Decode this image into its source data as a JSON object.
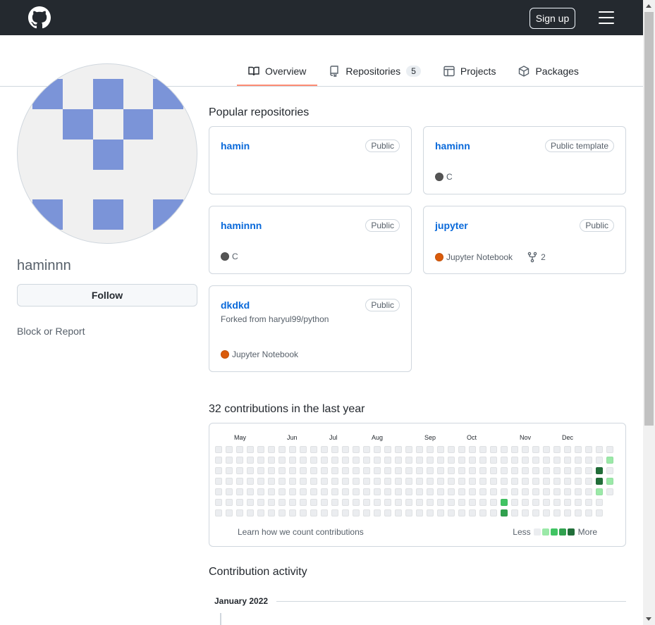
{
  "header": {
    "logo_icon": "github-mark-icon",
    "signup_label": "Sign up",
    "menu_icon": "hamburger-menu-icon"
  },
  "tabs": [
    {
      "label": "Overview",
      "icon": "book-icon",
      "active": true
    },
    {
      "label": "Repositories",
      "icon": "repo-icon",
      "count": "5"
    },
    {
      "label": "Projects",
      "icon": "table-icon"
    },
    {
      "label": "Packages",
      "icon": "package-icon"
    }
  ],
  "profile": {
    "username": "haminnn",
    "follow_label": "Follow",
    "block_label": "Block or Report",
    "avatar_color": "#7b94d8"
  },
  "popular": {
    "title": "Popular repositories",
    "repos": [
      {
        "name": "hamin",
        "visibility": "Public"
      },
      {
        "name": "haminn",
        "visibility": "Public template",
        "language": "C",
        "lang_color": "#555555"
      },
      {
        "name": "haminnn",
        "visibility": "Public",
        "language": "C",
        "lang_color": "#555555"
      },
      {
        "name": "jupyter",
        "visibility": "Public",
        "language": "Jupyter Notebook",
        "lang_color": "#DA5B0B",
        "forks": "2"
      },
      {
        "name": "dkdkd",
        "visibility": "Public",
        "forked_from": "Forked from haryul99/python",
        "language": "Jupyter Notebook",
        "lang_color": "#DA5B0B"
      }
    ]
  },
  "contributions": {
    "title": "32 contributions in the last year",
    "months": [
      "May",
      "Jun",
      "Jul",
      "Aug",
      "Sep",
      "Oct",
      "Nov",
      "Dec"
    ],
    "learn_label": "Learn how we count contributions",
    "less_label": "Less",
    "more_label": "More",
    "level_colors": [
      "#ebedf0",
      "#9be9a8",
      "#40c463",
      "#30a14e",
      "#216e39"
    ],
    "active_cells": [
      {
        "week": 27,
        "day": 5,
        "level": 2
      },
      {
        "week": 27,
        "day": 6,
        "level": 3
      },
      {
        "week": 36,
        "day": 2,
        "level": 4
      },
      {
        "week": 36,
        "day": 3,
        "level": 4
      },
      {
        "week": 36,
        "day": 4,
        "level": 1
      },
      {
        "week": 37,
        "day": 1,
        "level": 1
      },
      {
        "week": 37,
        "day": 3,
        "level": 1
      }
    ]
  },
  "activity": {
    "title": "Contribution activity",
    "month": "January 2022"
  }
}
